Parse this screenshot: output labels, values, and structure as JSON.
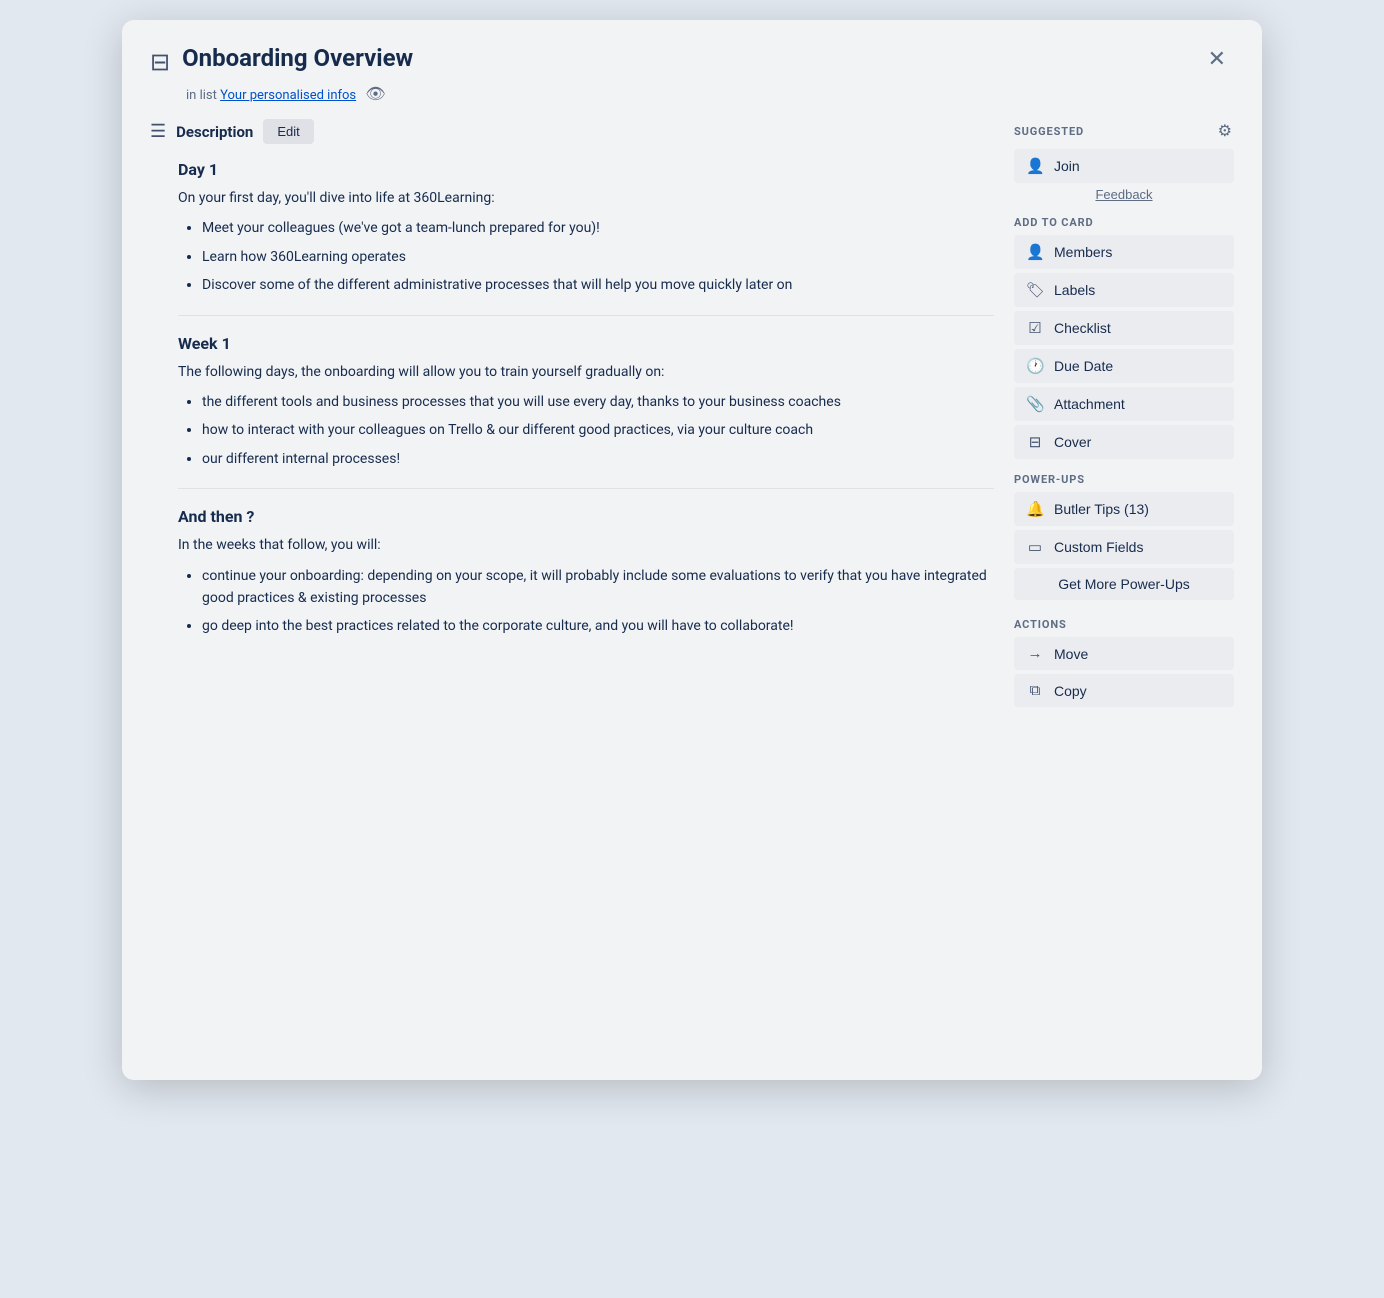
{
  "modal": {
    "title": "Onboarding Overview",
    "subtitle_prefix": "in list",
    "subtitle_link": "Your personalised infos",
    "close_label": "✕"
  },
  "description": {
    "section_title": "Description",
    "edit_label": "Edit",
    "day1_heading": "Day 1",
    "day1_intro": "On your first day, you'll dive into life at 360Learning:",
    "day1_bullets": [
      "Meet your colleagues (we've got a team-lunch prepared for you)!",
      "Learn how 360Learning operates",
      "Discover some of the different administrative processes that will help you move quickly later on"
    ],
    "week1_heading": "Week 1",
    "week1_intro": "The following days, the onboarding will allow you to train yourself gradually on:",
    "week1_bullets": [
      "the different tools and business processes that you will use every day, thanks to your business coaches",
      "how to interact with your colleagues on Trello & our different good practices, via your culture coach",
      "our different internal processes!"
    ],
    "andthen_heading": "And then ?",
    "andthen_intro": "In the weeks that follow, you will:",
    "andthen_bullets": [
      "continue your onboarding: depending on your scope, it will probably include some evaluations to verify that you have integrated good practices & existing processes",
      "go deep into the best practices related to the corporate culture, and you will have to collaborate!"
    ]
  },
  "sidebar": {
    "suggested_label": "SUGGESTED",
    "join_label": "Join",
    "feedback_label": "Feedback",
    "add_to_card_label": "ADD TO CARD",
    "members_label": "Members",
    "labels_label": "Labels",
    "checklist_label": "Checklist",
    "due_date_label": "Due Date",
    "attachment_label": "Attachment",
    "cover_label": "Cover",
    "power_ups_label": "POWER-UPS",
    "butler_tips_label": "Butler Tips (13)",
    "custom_fields_label": "Custom Fields",
    "get_more_label": "Get More Power-Ups",
    "actions_label": "ACTIONS",
    "move_label": "Move",
    "copy_label": "Copy"
  },
  "colors": {
    "accent": "#0052cc",
    "sidebar_bg": "#ebecf0",
    "text_dark": "#172b4d",
    "text_mid": "#42526e",
    "text_light": "#5e6c84"
  }
}
